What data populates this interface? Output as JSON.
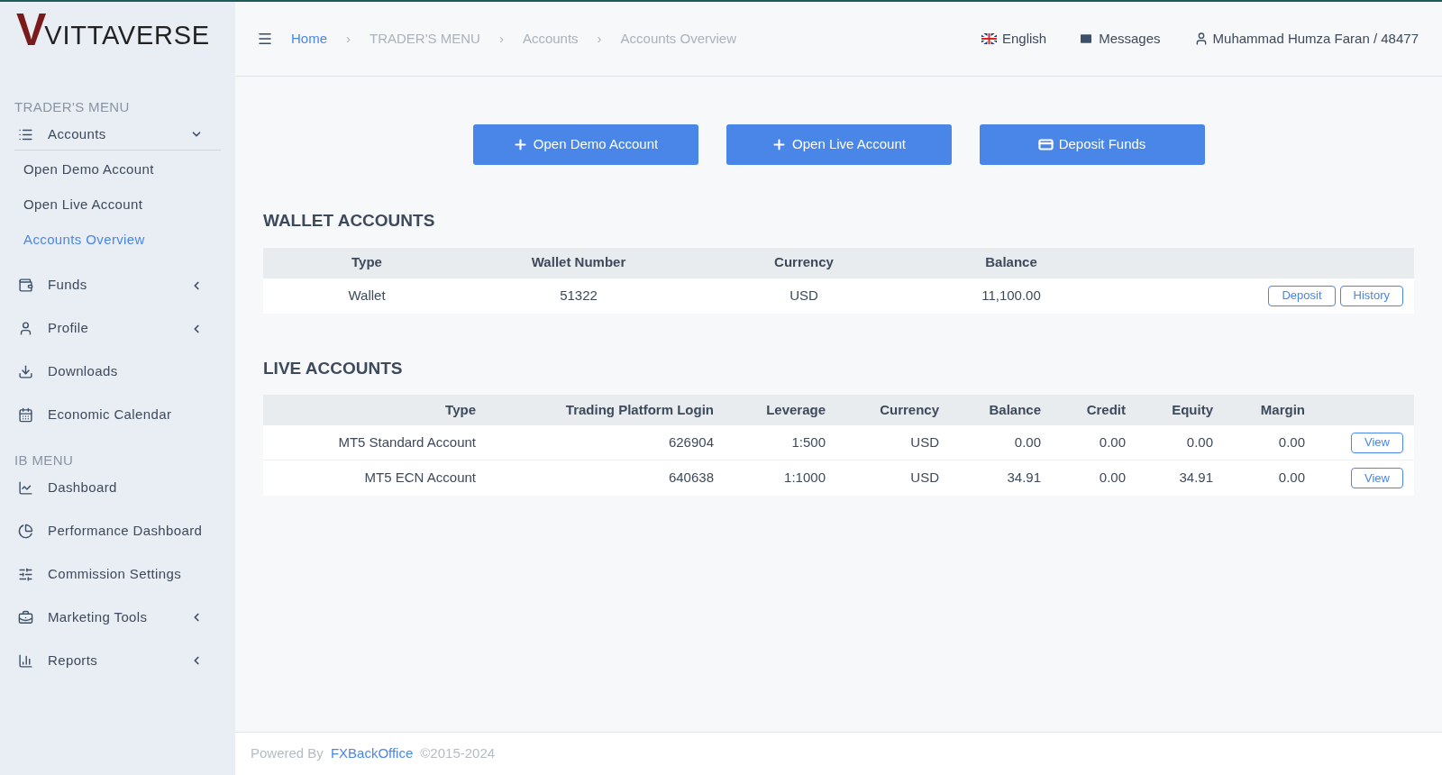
{
  "logo": {
    "mark": "V",
    "text": "VITTAVERSE"
  },
  "sidebar": {
    "sections": [
      {
        "title": "TRADER'S MENU",
        "items": [
          {
            "kind": "submenu",
            "label": "Accounts",
            "expanded": true,
            "children": [
              {
                "label": "Open Demo Account",
                "selected": false
              },
              {
                "label": "Open Live Account",
                "selected": false
              },
              {
                "label": "Accounts Overview",
                "selected": true
              }
            ]
          },
          {
            "kind": "submenu",
            "label": "Funds",
            "expanded": false
          },
          {
            "kind": "submenu",
            "label": "Profile",
            "expanded": false
          },
          {
            "kind": "link",
            "label": "Downloads"
          },
          {
            "kind": "link",
            "label": "Economic Calendar"
          }
        ]
      },
      {
        "title": "IB MENU",
        "items": [
          {
            "kind": "link",
            "label": "Dashboard"
          },
          {
            "kind": "link",
            "label": "Performance Dashboard"
          },
          {
            "kind": "link",
            "label": "Commission Settings"
          },
          {
            "kind": "submenu",
            "label": "Marketing Tools",
            "expanded": false
          },
          {
            "kind": "submenu",
            "label": "Reports",
            "expanded": false
          }
        ]
      }
    ]
  },
  "breadcrumb": [
    {
      "label": "Home",
      "link": true
    },
    {
      "separator": "›",
      "label": "TRADER'S MENU",
      "link": false
    },
    {
      "separator": "›",
      "label": "Accounts",
      "link": false
    },
    {
      "separator": "›",
      "label": "Accounts Overview",
      "link": false
    }
  ],
  "header_links": {
    "language": "English",
    "messages": "Messages",
    "user": "Muhammad Humza Faran / 48477"
  },
  "actions": [
    "Open Demo Account",
    "Open Live Account",
    "Deposit Funds"
  ],
  "wallet_accounts": {
    "title": "WALLET ACCOUNTS",
    "columns": [
      "Type",
      "Wallet Number",
      "Currency",
      "Balance"
    ],
    "rows": [
      {
        "cells": [
          "Wallet",
          "51322",
          "USD",
          "11,100.00"
        ],
        "buttons": [
          "Deposit",
          "History"
        ]
      }
    ]
  },
  "live_accounts": {
    "title": "LIVE ACCOUNTS",
    "columns": [
      "Type",
      "Trading Platform Login",
      "Leverage",
      "Currency",
      "Balance",
      "Credit",
      "Equity",
      "Margin"
    ],
    "rows": [
      {
        "cells": [
          "MT5 Standard Account",
          "626904",
          "1:500",
          "USD",
          "0.00",
          "0.00",
          "0.00",
          "0.00"
        ],
        "buttons": [
          "View"
        ]
      },
      {
        "cells": [
          "MT5 ECN Account",
          "640638",
          "1:1000",
          "USD",
          "34.91",
          "0.00",
          "34.91",
          "0.00"
        ],
        "buttons": [
          "View"
        ]
      }
    ]
  },
  "footer": {
    "prefix": "Powered By",
    "link": "FXBackOffice",
    "copyright": "©2015-2024"
  }
}
